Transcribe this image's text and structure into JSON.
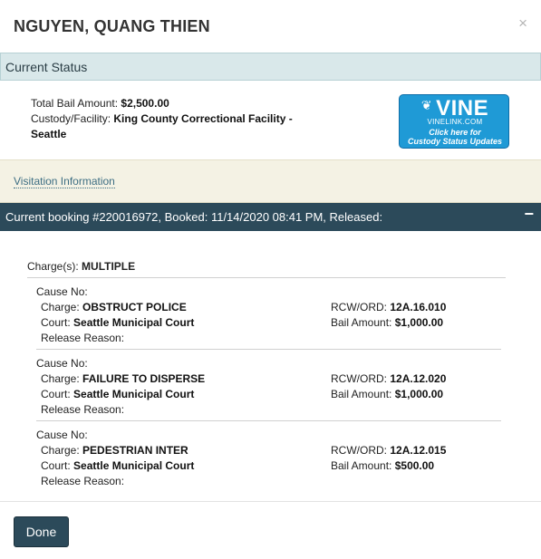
{
  "header": {
    "title": "NGUYEN, QUANG THIEN",
    "close_glyph": "×"
  },
  "status": {
    "section_label": "Current Status"
  },
  "summary": {
    "bail_label": "Total Bail Amount:",
    "bail_value": "$2,500.00",
    "facility_label": "Custody/Facility:",
    "facility_value": "King County Correctional Facility - Seattle"
  },
  "vine_badge": {
    "logo_text": "VINE",
    "site_text": "VINELINK.COM",
    "cta_line1": "Click here for",
    "cta_line2": "Custody Status Updates",
    "colors": {
      "background": "#1f9ad6"
    }
  },
  "visitation": {
    "link_label": "Visitation Information"
  },
  "booking": {
    "bar_label": "Current booking #220016972, Booked: 11/14/2020 08:41 PM, Released:",
    "toggle_glyph": "−",
    "charges_label": "Charge(s):",
    "charges_value": "MULTIPLE",
    "field_labels": {
      "cause": "Cause No:",
      "charge": "Charge:",
      "court": "Court:",
      "release": "Release Reason:",
      "rcw": "RCW/ORD:",
      "bail": "Bail Amount:"
    },
    "charges": [
      {
        "cause_no": "",
        "charge": "OBSTRUCT POLICE",
        "court": "Seattle Municipal Court",
        "release_reason": "",
        "rcw_ord": "12A.16.010",
        "bail_amount": "$1,000.00"
      },
      {
        "cause_no": "",
        "charge": "FAILURE TO DISPERSE",
        "court": "Seattle Municipal Court",
        "release_reason": "",
        "rcw_ord": "12A.12.020",
        "bail_amount": "$1,000.00"
      },
      {
        "cause_no": "",
        "charge": "PEDESTRIAN INTER",
        "court": "Seattle Municipal Court",
        "release_reason": "",
        "rcw_ord": "12A.12.015",
        "bail_amount": "$500.00"
      }
    ]
  },
  "footer": {
    "done_label": "Done"
  },
  "colors": {
    "booking_bar": "#2c4a5a",
    "status_bar": "#d9e8ea",
    "visitation_bg": "#f4f2e4",
    "accent_link": "#3d6e83"
  }
}
